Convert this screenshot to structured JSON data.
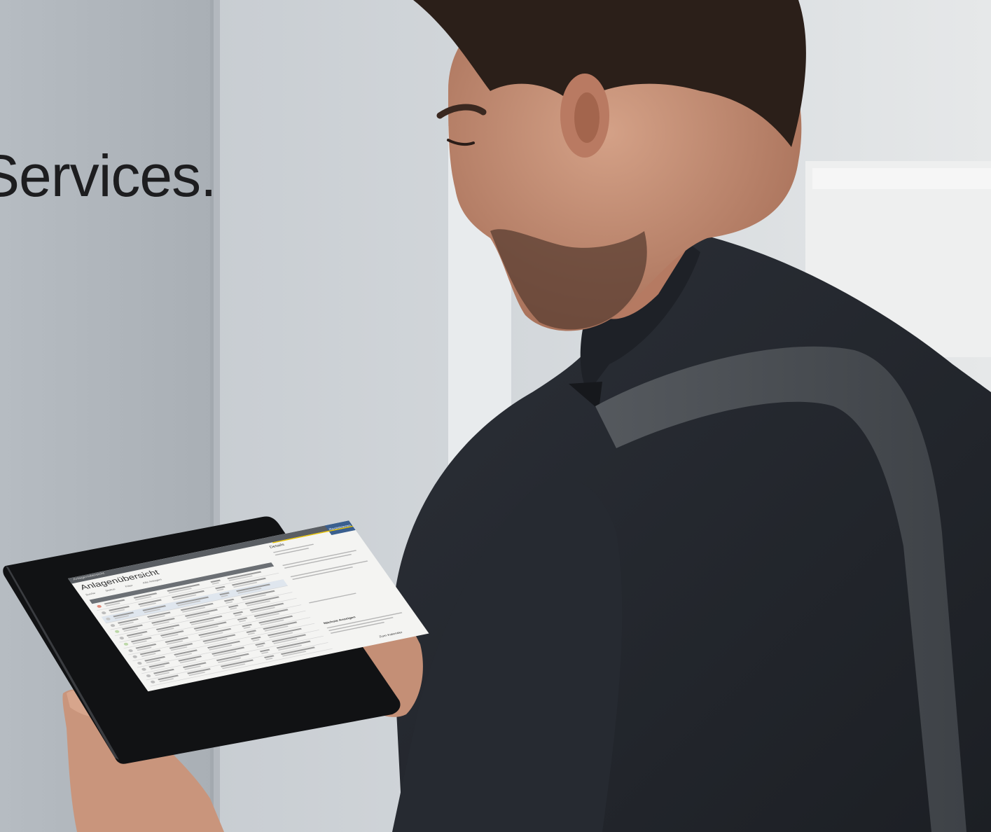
{
  "headline": {
    "text": "Services."
  },
  "tablet_ui": {
    "breadcrumb": "Anlagenübersicht",
    "page_title": "Anlagenübersicht",
    "header_button": "Registrieren",
    "panel_title": "Details",
    "panel_section": "Nächste Anzeigen",
    "panel_footer": "Zum Kalender",
    "toolbar": [
      "Suche",
      "Status",
      "Filter",
      "Alle Anlagen"
    ]
  },
  "colors": {
    "wall": "#c9ced3",
    "shirt": "#23262c",
    "tablet_frame": "#111214",
    "ui_accent": "#e7c200",
    "ui_header": "#5a5e63",
    "ui_button": "#3a5f8f"
  }
}
